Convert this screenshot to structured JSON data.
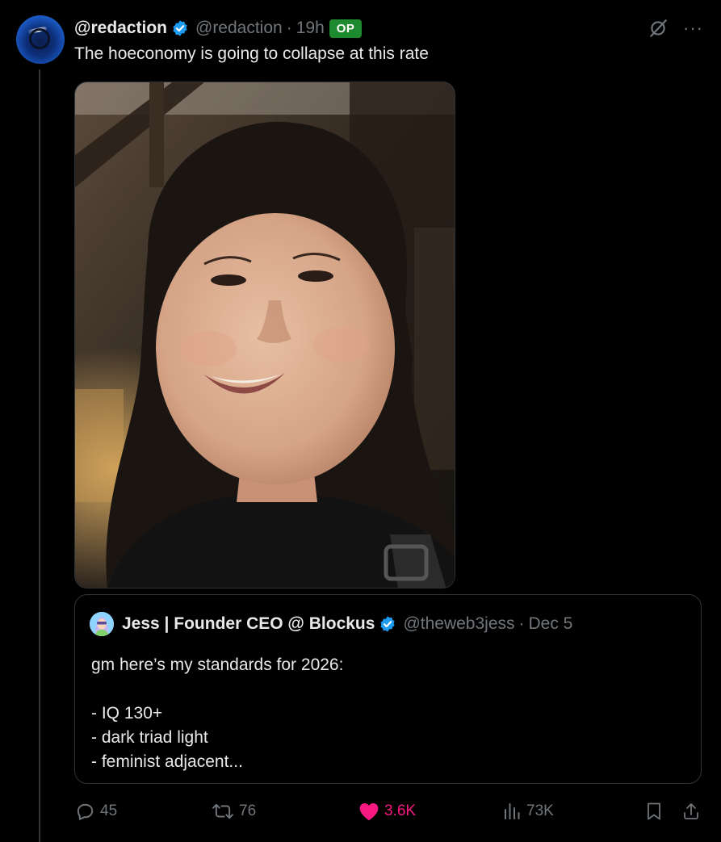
{
  "post": {
    "display_name": "@redaction",
    "handle": "@redaction",
    "separator": "·",
    "time": "19h",
    "op_badge": "OP",
    "text": "The hoeconomy is going to collapse at this rate"
  },
  "quoted_post": {
    "display_name": "Jess | Founder CEO @ Blockus",
    "handle": "@theweb3jess",
    "separator": "·",
    "date": "Dec 5",
    "lines": [
      "gm here’s my standards for 2026:",
      "",
      "- IQ 130+",
      "- dark triad light",
      "- feminist adjacent..."
    ]
  },
  "actions": {
    "replies": "45",
    "reposts": "76",
    "likes": "3.6K",
    "views": "73K"
  },
  "icons": {
    "verified": "verified-badge-icon",
    "grok": "grok-icon",
    "more": "more-icon",
    "reply": "reply-icon",
    "repost": "repost-icon",
    "like": "heart-icon",
    "views": "views-icon",
    "bookmark": "bookmark-icon",
    "share": "share-icon"
  },
  "colors": {
    "background": "#000000",
    "text": "#e7e9ea",
    "secondary_text": "#71767b",
    "verified_blue": "#1d9bf0",
    "op_green": "#1e8a2f",
    "like_pink": "#f91880",
    "border": "#2f3336"
  }
}
